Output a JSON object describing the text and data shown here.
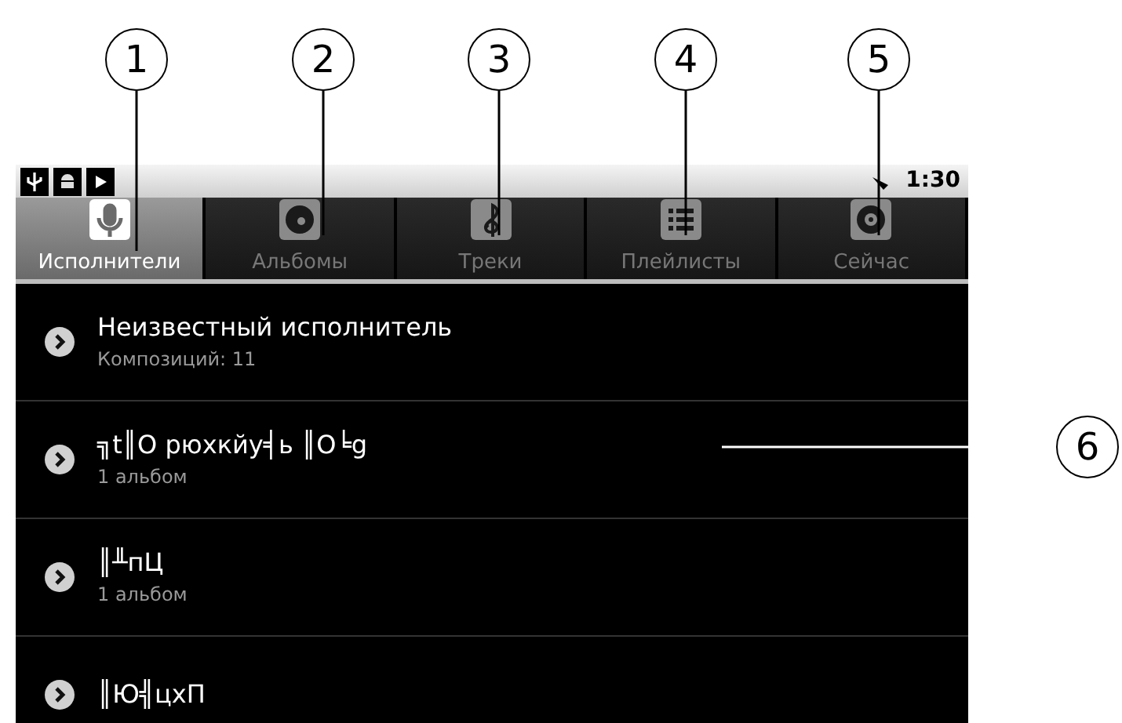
{
  "callouts": [
    {
      "label": "1"
    },
    {
      "label": "2"
    },
    {
      "label": "3"
    },
    {
      "label": "4"
    },
    {
      "label": "5"
    },
    {
      "label": "6"
    }
  ],
  "status_bar": {
    "time": "1:30"
  },
  "tabs": [
    {
      "label": "Исполнители",
      "selected": true,
      "kind": "mic"
    },
    {
      "label": "Альбомы",
      "selected": false,
      "kind": "disc"
    },
    {
      "label": "Треки",
      "selected": false,
      "kind": "clef"
    },
    {
      "label": "Плейлисты",
      "selected": false,
      "kind": "list"
    },
    {
      "label": "Сейчас",
      "selected": false,
      "kind": "now"
    }
  ],
  "artists": [
    {
      "name": "Неизвестный исполнитель",
      "detail": "Композиций: 11"
    },
    {
      "name": "╗t║O рюхкйу╡ь ║O╘g",
      "detail": "1 альбом"
    },
    {
      "name": "║╨пЦ",
      "detail": "1 альбом"
    },
    {
      "name": "║Ю╣цхП"
    }
  ]
}
